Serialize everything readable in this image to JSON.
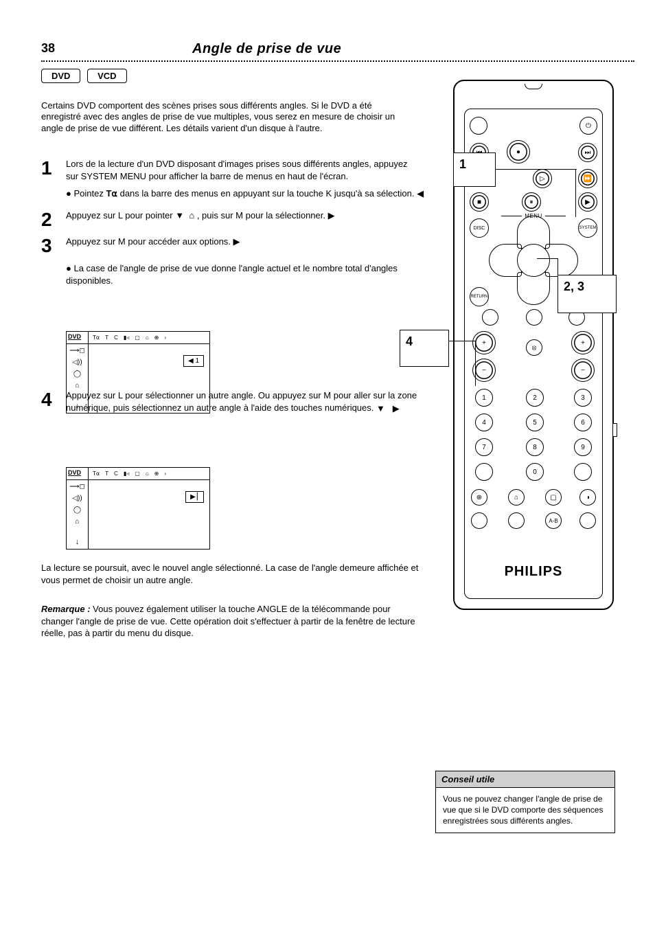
{
  "page_number": "38",
  "page_title": "Angle de prise de vue",
  "pills": [
    "DVD",
    "VCD"
  ],
  "intro": "Certains DVD comportent des scènes prises sous différents angles. Si le DVD a été enregistré avec des angles de prise de vue multiples, vous serez en mesure de choisir un angle de prise de vue différent. Les détails varient d'un disque à l'autre.",
  "steps": {
    "1": {
      "body_a": "Lors de la lecture d'un DVD disposant d'images prises sous différents angles, appuyez sur SYSTEM MENU pour afficher la barre de menus en haut de l'écran.",
      "bullet": "Pointez ",
      "bullet_tail": " dans la barre des menus en appuyant sur la touche K jusqu'à sa sélection."
    },
    "2": {
      "body": "Appuyez sur L pour pointer ",
      "body_tail": " , puis sur M pour la sélectionner."
    },
    "3": {
      "body": "Appuyez sur M pour accéder aux options.",
      "bullet": "La case de l'angle de prise de vue donne l'angle actuel et le nombre total d'angles disponibles."
    },
    "4": {
      "body": "Appuyez sur L pour sélectionner un autre angle. Ou appuyez sur M pour aller sur la zone numérique, puis sélectionnez un autre angle à l'aide des touches numériques."
    }
  },
  "screenA": {
    "dvd": "DVD",
    "tabs": [
      "T⍺",
      "T",
      "C",
      "▮◃",
      "▢",
      "⌂",
      "⊕"
    ],
    "side": [
      "⟶◻",
      "◁))",
      "◯",
      "⌂"
    ],
    "box": "◀  1"
  },
  "screenB": {
    "dvd": "DVD",
    "tabs": [
      "T⍺",
      "T",
      "C",
      "▮◃",
      "▢",
      "⌂",
      "⊕"
    ],
    "side": [
      "⟶◻",
      "◁))",
      "◯",
      "⌂"
    ],
    "box": "▶⎮"
  },
  "resume": "La lecture se poursuit, avec le nouvel angle sélectionné. La case de l'angle demeure affichée et vous permet de choisir un autre angle.",
  "note_label": "Remarque :",
  "note_body": "Vous pouvez également utiliser la touche ANGLE de la télécommande pour changer l'angle de prise de vue. Cette opération doit s'effectuer à partir de la fenêtre de lecture réelle, pas à partir du menu du disque.",
  "remote": {
    "menu_label": "MENU",
    "disc": "DISC",
    "system": "SYSTEM",
    "return": "RETURN",
    "mute": "⦻",
    "numbers": [
      "1",
      "2",
      "3",
      "4",
      "5",
      "6",
      "7",
      "8",
      "9",
      "0"
    ],
    "ab": "A-B",
    "brand": "PHILIPS"
  },
  "callouts": {
    "1": "1",
    "2": "2, 3",
    "3": "4"
  },
  "tip": {
    "head": "Conseil utile",
    "body": "Vous ne pouvez changer l'angle de prise de vue que si le DVD comporte des séquences enregistrées sous différents angles."
  }
}
